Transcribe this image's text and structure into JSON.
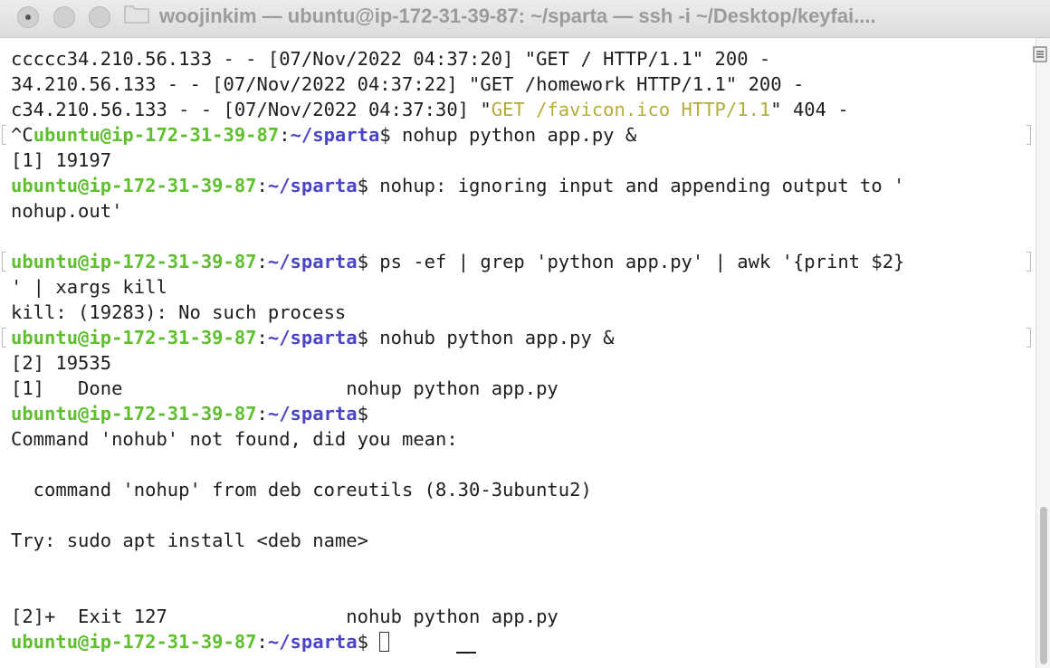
{
  "window": {
    "title": "woojinkim — ubuntu@ip-172-31-39-87: ~/sparta — ssh -i ~/Desktop/keyfai...."
  },
  "prompt": {
    "user_host": "ubuntu@ip-172-31-39-87",
    "colon": ":",
    "path": "~/sparta",
    "dollar": "$"
  },
  "terminal": {
    "log1": "ccccc34.210.56.133 - - [07/Nov/2022 04:37:20] \"GET / HTTP/1.1\" 200 -",
    "log2": "34.210.56.133 - - [07/Nov/2022 04:37:22] \"GET /homework HTTP/1.1\" 200 -",
    "log3_pre": "c34.210.56.133 - - [07/Nov/2022 04:37:30] \"",
    "log3_hl": "GET /favicon.ico HTTP/1.1",
    "log3_post": "\" 404 -",
    "ctrl_c": "^C",
    "cmd1": " nohup python app.py &",
    "job1": "[1] 19197",
    "cmd2_out": " nohup: ignoring input and appending output to '",
    "cmd2_out_cont": "nohup.out'",
    "cmd3": " ps -ef | grep 'python app.py' | awk '{print $2}",
    "cmd3_cont": "' | xargs kill",
    "kill_err": "kill: (19283): No such process",
    "cmd4": " nohub python app.py &",
    "job2": "[2] 19535",
    "done": "[1]   Done                    nohup python app.py",
    "notfound": "Command 'nohub' not found, did you mean:",
    "suggest": "  command 'nohup' from deb coreutils (8.30-3ubuntu2)",
    "try": "Try: sudo apt install <deb name>",
    "exit": "[2]+  Exit 127                nohub python app.py"
  },
  "colors": {
    "prompt_user": "#5fbf2e",
    "prompt_path": "#4a44c8",
    "highlight": "#b5ad36"
  },
  "icons": [
    "folder-icon",
    "scroll-lines-icon",
    "cursor-block"
  ]
}
